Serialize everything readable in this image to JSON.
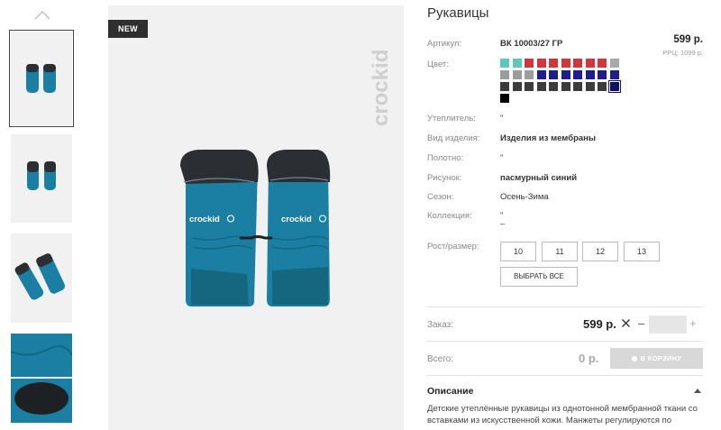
{
  "gallery": {
    "badge": "NEW",
    "brand_logo": "crockid",
    "glove_logo": "crockid",
    "thumbnails": [
      "thumb-front-pair",
      "thumb-back-pair",
      "thumb-angled",
      "thumb-closeup"
    ]
  },
  "product": {
    "title": "Рукавицы",
    "article_label": "Артикул:",
    "article_value": "ВК 10003/27 ГР",
    "price": "599 р.",
    "rrc": "РРЦ: 1099 р.",
    "color_label": "Цвет:",
    "swatches": [
      [
        "#5ec8b6",
        "#5ec8b6",
        "#d2353b",
        "#d2353b",
        "#d2353b",
        "#d2353b",
        "#d2353b",
        "#d2353b",
        "#d2353b",
        "#a9a9a9"
      ],
      [
        "#9c9c9c",
        "#9c9c9c",
        "#9c9c9c",
        "#1e1e8a",
        "#1e1e8a",
        "#1e1e8a",
        "#1e1e8a",
        "#1e1e8a",
        "#1e1e8a",
        "#1e1e8a"
      ],
      [
        "#3c3c3c",
        "#3c3c3c",
        "#3c3c3c",
        "#3c3c3c",
        "#3c3c3c",
        "#3c3c3c",
        "#3c3c3c",
        "#3c3c3c",
        "#3c3c3c",
        "#0e0e6e"
      ],
      [
        "#000000"
      ]
    ],
    "selected_swatch": "#0e0e6e",
    "attributes": [
      {
        "label": "Утеплитель:",
        "value": "\"",
        "bold": false
      },
      {
        "label": "Вид изделия:",
        "value": "Изделия из мембраны",
        "bold": true
      },
      {
        "label": "Полотно:",
        "value": "\"",
        "bold": false
      },
      {
        "label": "Рисунок:",
        "value": "пасмурный синий",
        "bold": true
      },
      {
        "label": "Сезон:",
        "value": "Осень-Зима",
        "bold": false
      },
      {
        "label": "Коллекция:",
        "value": "\"",
        "value2": "–",
        "bold": false
      }
    ],
    "size_label": "Рост/размер:",
    "sizes": [
      "10",
      "11",
      "12",
      "13"
    ],
    "select_all": "ВЫБРАТЬ ВСЕ"
  },
  "order": {
    "label": "Заказ:",
    "price": "599 р.",
    "qty": "",
    "minus": "–",
    "plus": "+"
  },
  "total": {
    "label": "Всего:",
    "value": "0 р.",
    "cart_button": "В КОРЗИНУ"
  },
  "description": {
    "title": "Описание",
    "text": "Детские утеплённые рукавицы из однотонной мембранной ткани со вставками из искусственной кожи. Манжеты регулируются по"
  },
  "colors": {
    "glove": "#1a7fa3",
    "glove_dark": "#15667f",
    "glove_top": "#2b2f33",
    "badge_bg": "#2f2f2f"
  }
}
